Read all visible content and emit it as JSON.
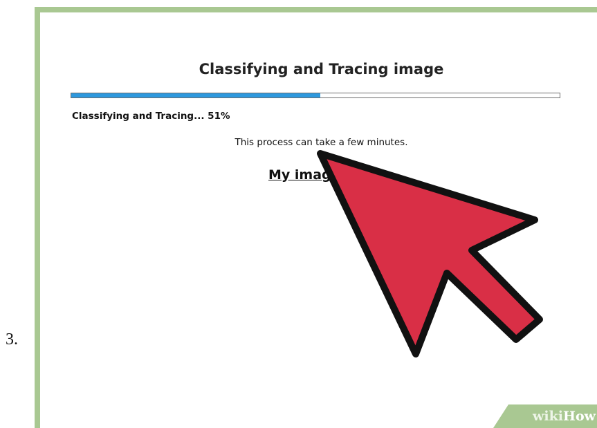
{
  "step": {
    "number": "3."
  },
  "dialog": {
    "title": "Classifying and Tracing image",
    "progress": {
      "percent": 51,
      "status_text": "Classifying and Tracing... 51%"
    },
    "note": "This process can take a few minutes.",
    "link_label": "My images"
  },
  "overlay": {
    "cursor_icon": "arrow-cursor-icon",
    "cursor_color": "#d92f46",
    "cursor_outline_color": "#111111"
  },
  "watermark": {
    "text": "wikiHow"
  },
  "colors": {
    "frame": "#a9c892",
    "progress_fill": "#2e98dd",
    "background": "#ffffff"
  }
}
